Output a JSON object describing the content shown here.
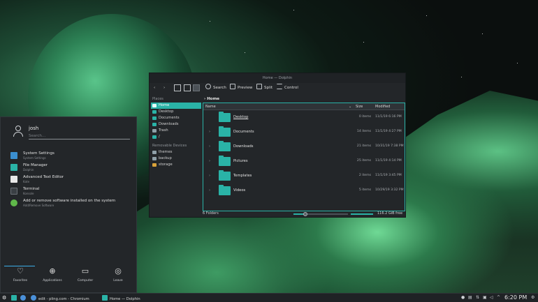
{
  "dolphin": {
    "title": "Home — Dolphin",
    "toolbar": {
      "search": "Search",
      "preview": "Preview",
      "split": "Split",
      "control": "Control"
    },
    "places_header": "Places",
    "places": [
      "Home",
      "Desktop",
      "Documents",
      "Downloads",
      "Trash",
      "/"
    ],
    "removable_header": "Removable Devices",
    "removable": [
      "themes",
      "backup",
      "storage"
    ],
    "breadcrumb": "Home",
    "columns": {
      "name": "Name",
      "size": "Size",
      "modified": "Modified"
    },
    "files": [
      {
        "name": "Desktop",
        "count": "0 items",
        "modified": "11/1/19 6:16 PM"
      },
      {
        "name": "Documents",
        "count": "14 items",
        "modified": "11/1/19 4:27 PM"
      },
      {
        "name": "Downloads",
        "count": "21 items",
        "modified": "10/31/19 7:38 PM"
      },
      {
        "name": "Pictures",
        "count": "25 items",
        "modified": "11/1/19 4:14 PM"
      },
      {
        "name": "Templates",
        "count": "2 items",
        "modified": "11/1/19 3:45 PM"
      },
      {
        "name": "Videos",
        "count": "5 items",
        "modified": "10/29/19 3:32 PM"
      }
    ],
    "status_folders": "6 Folders",
    "free_space": "116.2 GiB free"
  },
  "launcher": {
    "username": "josh",
    "search_placeholder": "Search...",
    "apps": [
      {
        "title": "System Settings",
        "subtitle": "System Settings",
        "color": "#3b8fd0"
      },
      {
        "title": "File Manager",
        "subtitle": "Dolphin",
        "color": "#2ab3a7"
      },
      {
        "title": "Advanced Text Editor",
        "subtitle": "Kate",
        "color": "#e8e8e8"
      },
      {
        "title": "Terminal",
        "subtitle": "Konsole",
        "color": "#3a3f44"
      },
      {
        "title": "Add or remove software installed on the system",
        "subtitle": "Add/Remove Software",
        "color": "#5fb84a"
      }
    ],
    "dock": [
      "Favorites",
      "Applications",
      "Computer",
      "Leave"
    ]
  },
  "taskbar": {
    "chromium_task": "edit - pling.com - Chromium",
    "dolphin_task": "Home — Dolphin",
    "clock": "6:20 PM"
  },
  "colors": {
    "accent": "#2ab3a7",
    "panel": "#232629"
  }
}
